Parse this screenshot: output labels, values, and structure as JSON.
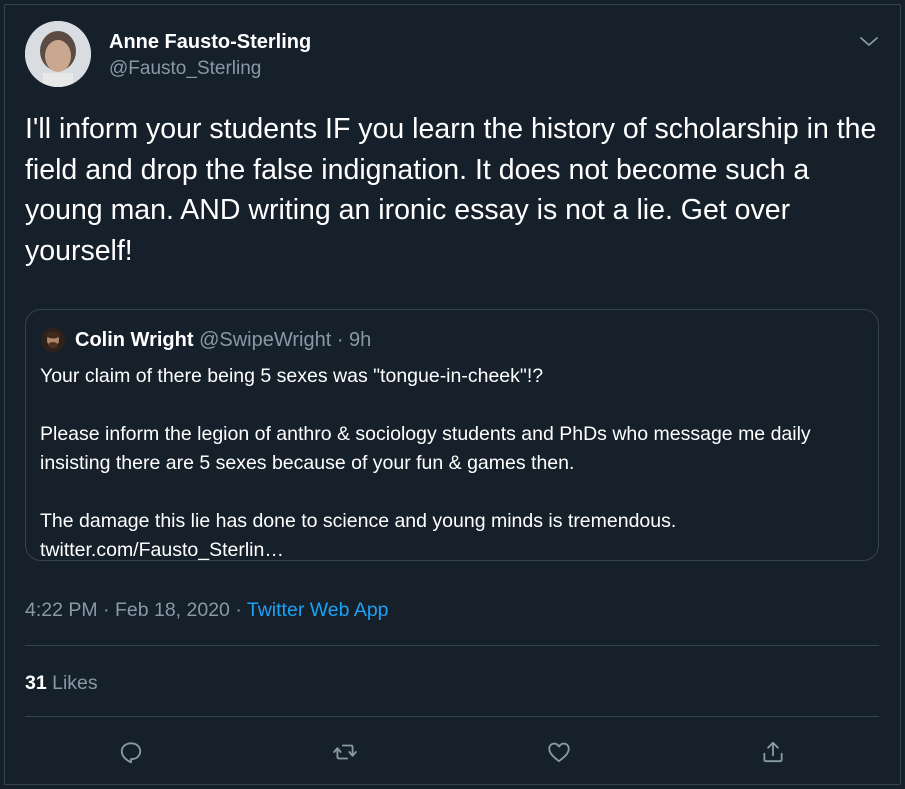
{
  "author": {
    "name": "Anne Fausto-Sterling",
    "handle": "@Fausto_Sterling"
  },
  "tweet_text": "I'll inform your students IF you learn the history of scholarship in the field and drop the false indignation. It does not become such a young man. AND writing an ironic essay is not a lie. Get over yourself!",
  "quoted_tweet": {
    "name": "Colin Wright",
    "handle": "@SwipeWright",
    "separator": " · ",
    "age": "9h",
    "paragraphs": [
      "Your claim of there being 5 sexes was \"tongue-in-cheek\"!?",
      "Please inform the legion of anthro & sociology students and PhDs who message me daily insisting there are 5 sexes because of your fun & games then.",
      "The damage this lie has done to science and young minds is tremendous. twitter.com/Fausto_Sterlin…"
    ]
  },
  "meta": {
    "time": "4:22 PM",
    "separator1": " · ",
    "date": "Feb 18, 2020",
    "separator2": " · ",
    "app": "Twitter Web App"
  },
  "likes": {
    "count": "31",
    "label": "Likes"
  },
  "icons": {
    "caret": "chevron-down-icon",
    "reply": "reply-icon",
    "retweet": "retweet-icon",
    "like": "like-icon",
    "share": "share-icon"
  },
  "colors": {
    "background": "#15202b",
    "border": "#38444d",
    "text": "#ffffff",
    "secondary": "#8899a6",
    "accent": "#1da1f2"
  }
}
